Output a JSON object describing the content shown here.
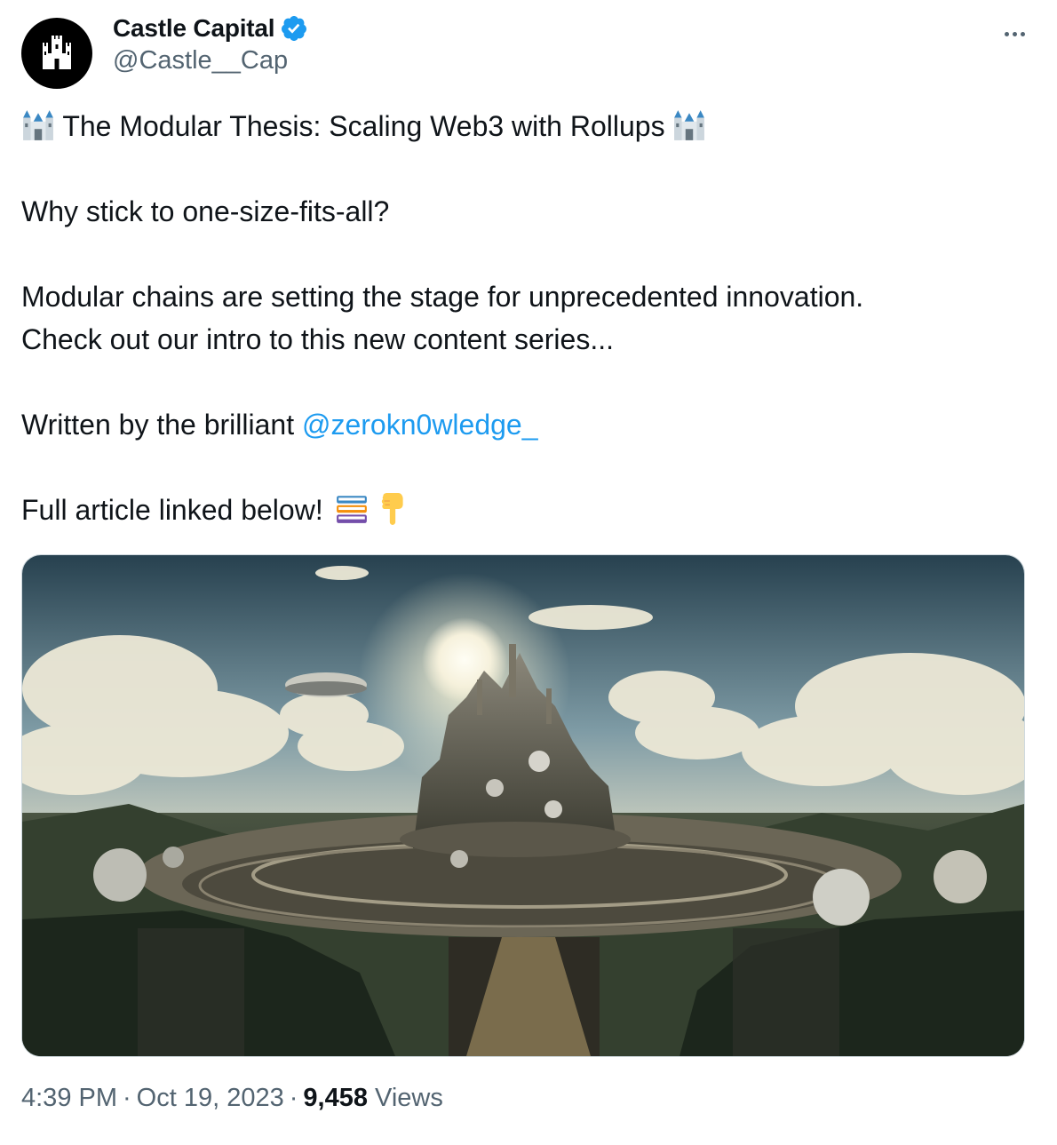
{
  "author": {
    "display_name": "Castle Capital",
    "handle": "@Castle__Cap",
    "verified": true,
    "avatar_icon": "castle-icon"
  },
  "menu": {
    "icon": "more-horizontal-icon"
  },
  "post": {
    "title": "The Modular Thesis: Scaling Web3 with Rollups",
    "title_emoji": "castle-emoji",
    "line_question": "Why stick to one-size-fits-all?",
    "line_modular": "Modular chains are setting the stage for unprecedented innovation.",
    "line_intro": "Check out our intro to this new content series...",
    "written_by": "Written by the brilliant",
    "mention": "@zerokn0wledge_",
    "full_article": "Full article linked below!",
    "trailing_emojis": [
      "books-emoji",
      "pointing-down-emoji"
    ]
  },
  "media": {
    "icon": "image-futuristic-city"
  },
  "meta": {
    "time": "4:39 PM",
    "date": "Oct 19, 2023",
    "views_count": "9,458",
    "views_label": "Views",
    "separator": "·"
  },
  "colors": {
    "text": "#0f1419",
    "secondary": "#536471",
    "link": "#1d9bf0",
    "verified": "#1d9bf0",
    "border": "#cfd9de"
  }
}
